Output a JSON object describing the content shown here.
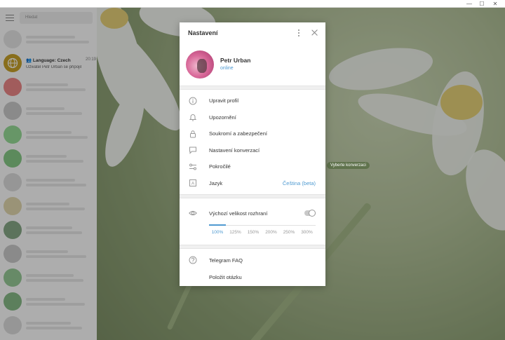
{
  "window": {
    "minimize": "—",
    "maximize": "☐",
    "close": "✕"
  },
  "sidebar": {
    "search_placeholder": "Hledat",
    "chat": {
      "title": "Language: Czech",
      "time": "20:19",
      "preview": "Uživatel Petr Urban se připojil"
    }
  },
  "background": {
    "badge": "Vyberte konverzaci"
  },
  "settings": {
    "title": "Nastavení",
    "profile": {
      "name": "Petr Urban",
      "status": "online"
    },
    "menu": [
      {
        "label": "Upravit profil",
        "icon": "info-icon"
      },
      {
        "label": "Upozornění",
        "icon": "bell-icon"
      },
      {
        "label": "Soukromí a zabezpečení",
        "icon": "lock-icon"
      },
      {
        "label": "Nastavení konverzací",
        "icon": "chat-bubble-icon"
      },
      {
        "label": "Pokročilé",
        "icon": "sliders-icon"
      },
      {
        "label": "Jazyk",
        "icon": "language-icon",
        "value": "Čeština (beta)"
      }
    ],
    "scale": {
      "label": "Výchozí velikost rozhraní",
      "default_enabled": false,
      "options": [
        "100%",
        "125%",
        "150%",
        "200%",
        "250%",
        "300%"
      ],
      "selected_index": 0
    },
    "footer": [
      {
        "label": "Telegram FAQ",
        "icon": "question-icon"
      },
      {
        "label": "Položit otázku",
        "icon": ""
      }
    ]
  },
  "colors": {
    "accent": "#4f9ad1",
    "language_avatar": "#c9a32a"
  }
}
